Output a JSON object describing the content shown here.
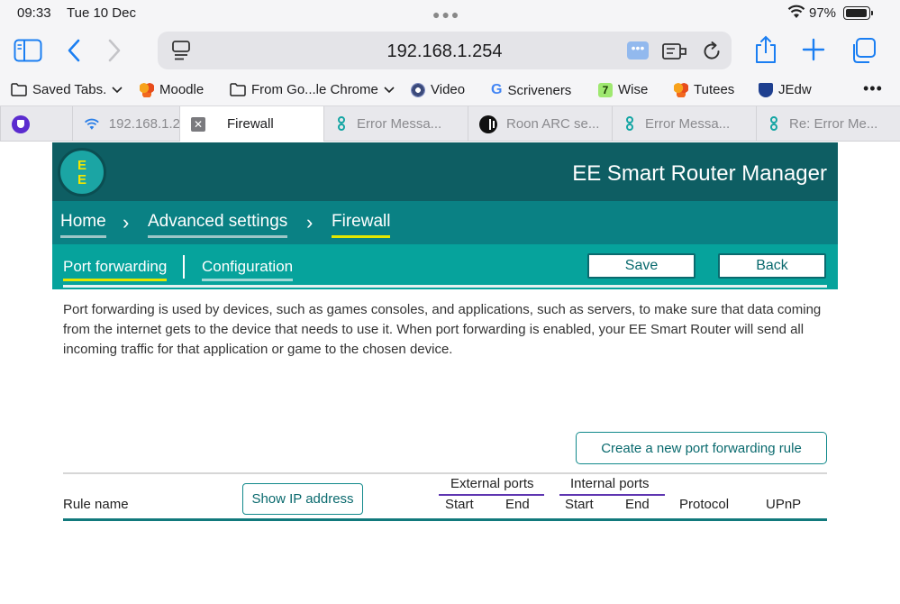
{
  "status_bar": {
    "time": "09:33",
    "date": "Tue 10 Dec",
    "battery": "97%",
    "battery_level": 0.97
  },
  "toolbar": {
    "url": "192.168.1.254"
  },
  "bookmarks": [
    {
      "label": "Saved Tabs.",
      "icon": "folder-icon",
      "has_chevron": true
    },
    {
      "label": "Moodle",
      "icon": "moodle-icon"
    },
    {
      "label": "From Go...le Chrome",
      "icon": "folder-icon",
      "has_chevron": true
    },
    {
      "label": "Video",
      "icon": "video-icon"
    },
    {
      "label": "Scriveners",
      "icon": "google-icon"
    },
    {
      "label": "Wise",
      "icon": "wise-icon"
    },
    {
      "label": "Tutees",
      "icon": "moodle-icon"
    },
    {
      "label": "JEdw",
      "icon": "shield-icon"
    }
  ],
  "tabs": [
    {
      "label": "192.168.1.2",
      "icon": "wifi-icon"
    },
    {
      "label": "Firewall",
      "active": true
    },
    {
      "label": "Error Messa...",
      "icon": "ee-icon"
    },
    {
      "label": "Roon ARC se...",
      "icon": "roon-icon"
    },
    {
      "label": "Error Messa...",
      "icon": "ee-icon"
    },
    {
      "label": "Re: Error Me...",
      "icon": "ee-icon"
    }
  ],
  "router": {
    "logo": "EE",
    "title": "EE Smart Router Manager",
    "breadcrumbs": [
      "Home",
      "Advanced settings",
      "Firewall"
    ],
    "subtabs": [
      "Port forwarding",
      "Configuration"
    ],
    "save_label": "Save",
    "back_label": "Back",
    "description": "Port forwarding is used by devices, such as games consoles, and applications, such as servers, to make sure that data coming from the internet gets to the device that needs to use it. When port forwarding is enabled, your EE Smart Router will send all incoming traffic for that application or game to the chosen device.",
    "create_rule_label": "Create a new port forwarding rule",
    "show_ip_label": "Show IP address",
    "table": {
      "rule_name": "Rule name",
      "external_ports": "External ports",
      "internal_ports": "Internal ports",
      "start": "Start",
      "end": "End",
      "protocol": "Protocol",
      "upnp": "UPnP"
    }
  }
}
